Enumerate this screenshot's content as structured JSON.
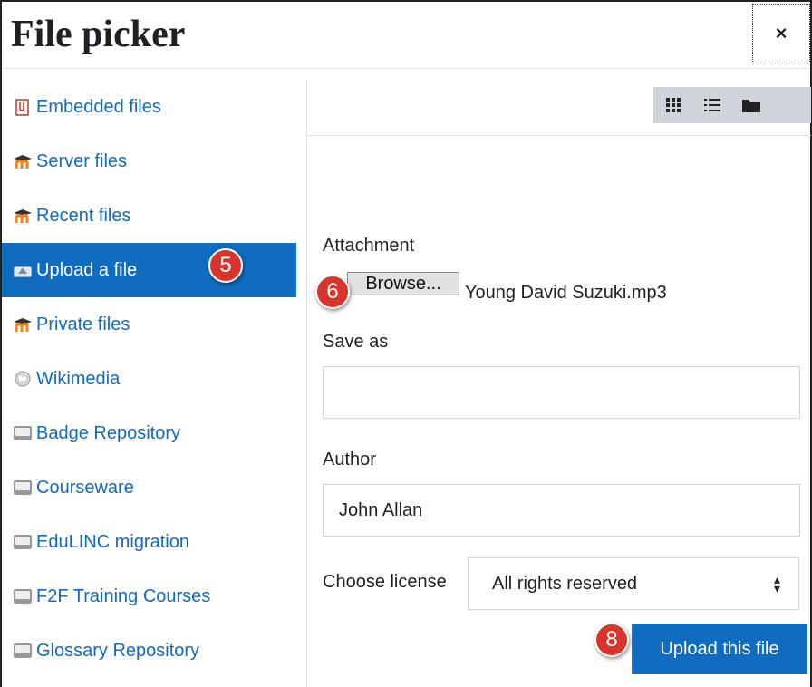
{
  "dialog": {
    "title": "File picker",
    "close_glyph": "×"
  },
  "sidebar": {
    "items": [
      {
        "label": "Embedded files",
        "icon": "embedded-files-icon"
      },
      {
        "label": "Server files",
        "icon": "moodle-icon"
      },
      {
        "label": "Recent files",
        "icon": "moodle-icon"
      },
      {
        "label": "Upload a file",
        "icon": "upload-icon",
        "active": true
      },
      {
        "label": "Private files",
        "icon": "moodle-icon"
      },
      {
        "label": "Wikimedia",
        "icon": "wikimedia-icon"
      },
      {
        "label": "Badge Repository",
        "icon": "repository-icon"
      },
      {
        "label": "Courseware",
        "icon": "repository-icon"
      },
      {
        "label": "EduLINC migration",
        "icon": "repository-icon"
      },
      {
        "label": "F2F Training Courses",
        "icon": "repository-icon"
      },
      {
        "label": "Glossary Repository",
        "icon": "repository-icon"
      }
    ]
  },
  "toolbar": {
    "views": [
      "grid-view-icon",
      "list-view-icon",
      "folder-view-icon"
    ]
  },
  "form": {
    "attachment_label": "Attachment",
    "browse_label": "Browse...",
    "file_name": "Young David Suzuki.mp3",
    "save_as_label": "Save as",
    "save_as_value": "",
    "author_label": "Author",
    "author_value": "John Allan",
    "license_label": "Choose license",
    "license_value": "All rights reserved",
    "upload_label": "Upload this file"
  },
  "annotations": {
    "step_upload": "5",
    "step_browse": "6",
    "step_submit": "8"
  },
  "colors": {
    "accent": "#0f6cbf",
    "badge": "#d9342b",
    "toolbar": "#ced4da"
  }
}
